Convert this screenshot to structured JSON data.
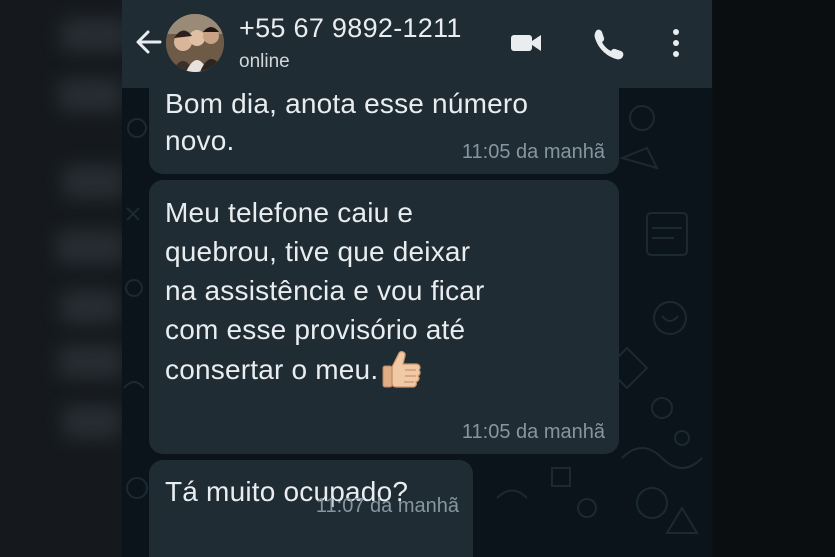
{
  "header": {
    "contact_name": "+55 67 9892-1211",
    "status": "online",
    "icons": [
      "back-arrow-icon",
      "video-call-icon",
      "phone-call-icon",
      "more-options-icon"
    ]
  },
  "messages": [
    {
      "text": "Bom dia, anota esse número\nnovo.",
      "time": "11:05 da manhã"
    },
    {
      "text": "Meu telefone caiu e\nquebrou, tive que deixar\nna assistência e vou ficar\ncom esse provisório até\nconsertar o meu.",
      "time": "11:05 da manhã",
      "emoji": "thumbs-up"
    },
    {
      "text": "Tá muito ocupado?",
      "time": "11:07 da manhã"
    }
  ],
  "colors": {
    "header_bg": "#1f2c34",
    "chat_bg": "#0b141a",
    "bubble_bg": "#1f2c34",
    "text": "#e9edef",
    "timestamp": "#8696a0"
  }
}
